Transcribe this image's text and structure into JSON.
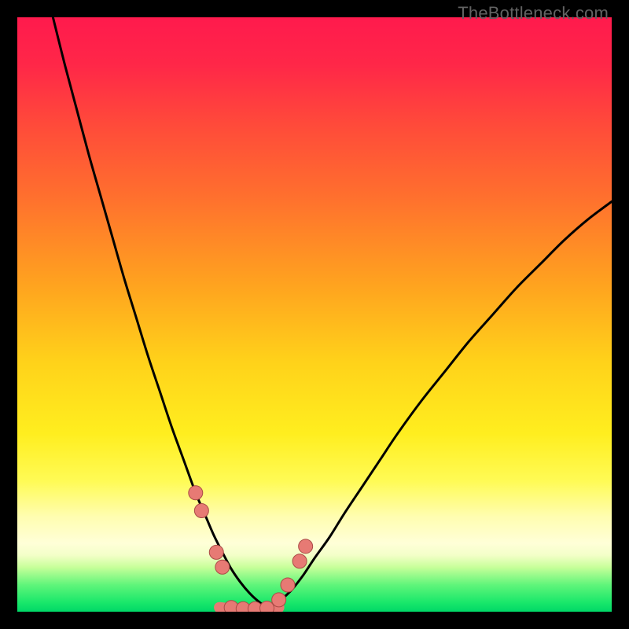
{
  "watermark": "TheBottleneck.com",
  "chart_data": {
    "type": "line",
    "title": "",
    "xlabel": "",
    "ylabel": "",
    "xlim": [
      0,
      100
    ],
    "ylim": [
      0,
      100
    ],
    "background_gradient": {
      "stops": [
        {
          "offset": 0.0,
          "color": "#ff1a4d"
        },
        {
          "offset": 0.08,
          "color": "#ff2748"
        },
        {
          "offset": 0.18,
          "color": "#ff4a3a"
        },
        {
          "offset": 0.3,
          "color": "#ff6f2e"
        },
        {
          "offset": 0.45,
          "color": "#ffa31f"
        },
        {
          "offset": 0.58,
          "color": "#ffd21a"
        },
        {
          "offset": 0.7,
          "color": "#ffee1f"
        },
        {
          "offset": 0.78,
          "color": "#fffb55"
        },
        {
          "offset": 0.84,
          "color": "#fffdb0"
        },
        {
          "offset": 0.885,
          "color": "#ffffd8"
        },
        {
          "offset": 0.905,
          "color": "#f3ffc8"
        },
        {
          "offset": 0.925,
          "color": "#c8ff9a"
        },
        {
          "offset": 0.955,
          "color": "#5ff57a"
        },
        {
          "offset": 0.985,
          "color": "#18e76a"
        },
        {
          "offset": 1.0,
          "color": "#00d867"
        }
      ]
    },
    "series": [
      {
        "name": "left-curve",
        "x": [
          6.0,
          8.0,
          10.0,
          12.0,
          14.0,
          16.0,
          18.0,
          20.0,
          22.0,
          24.0,
          26.0,
          28.0,
          30.0,
          31.5,
          33.0,
          34.5,
          36.0,
          37.5,
          39.0,
          40.5,
          42.0
        ],
        "y": [
          100.0,
          92.0,
          84.5,
          77.0,
          70.0,
          63.0,
          56.0,
          49.5,
          43.0,
          37.0,
          31.0,
          25.5,
          20.0,
          16.5,
          13.0,
          10.0,
          7.2,
          5.0,
          3.2,
          1.8,
          0.9
        ]
      },
      {
        "name": "right-curve",
        "x": [
          42.0,
          44.0,
          46.0,
          48.0,
          50.0,
          52.5,
          55.0,
          58.0,
          61.0,
          64.0,
          68.0,
          72.0,
          76.0,
          80.0,
          84.0,
          88.0,
          92.0,
          96.0,
          100.0
        ],
        "y": [
          0.9,
          1.8,
          3.5,
          6.0,
          9.0,
          12.5,
          16.5,
          21.0,
          25.5,
          30.0,
          35.5,
          40.5,
          45.5,
          50.0,
          54.5,
          58.5,
          62.5,
          66.0,
          69.0
        ]
      },
      {
        "name": "bottom-flat",
        "x": [
          34.0,
          36.0,
          38.0,
          40.0,
          42.0,
          44.0
        ],
        "y": [
          0.7,
          0.5,
          0.4,
          0.4,
          0.5,
          0.7
        ]
      }
    ],
    "markers": [
      {
        "series": "left-curve",
        "x": 30.0,
        "y": 20.0
      },
      {
        "series": "left-curve",
        "x": 31.0,
        "y": 17.0
      },
      {
        "series": "left-curve",
        "x": 33.5,
        "y": 10.0
      },
      {
        "series": "left-curve",
        "x": 34.5,
        "y": 7.5
      },
      {
        "series": "bottom-flat",
        "x": 36.0,
        "y": 0.7
      },
      {
        "series": "bottom-flat",
        "x": 38.0,
        "y": 0.5
      },
      {
        "series": "bottom-flat",
        "x": 40.0,
        "y": 0.5
      },
      {
        "series": "bottom-flat",
        "x": 42.0,
        "y": 0.6
      },
      {
        "series": "right-curve",
        "x": 44.0,
        "y": 2.0
      },
      {
        "series": "right-curve",
        "x": 45.5,
        "y": 4.5
      },
      {
        "series": "right-curve",
        "x": 47.5,
        "y": 8.5
      },
      {
        "series": "right-curve",
        "x": 48.5,
        "y": 11.0
      }
    ],
    "colors": {
      "curve": "#000000",
      "marker_fill": "#e77a74",
      "marker_stroke": "#aa4b46"
    }
  }
}
